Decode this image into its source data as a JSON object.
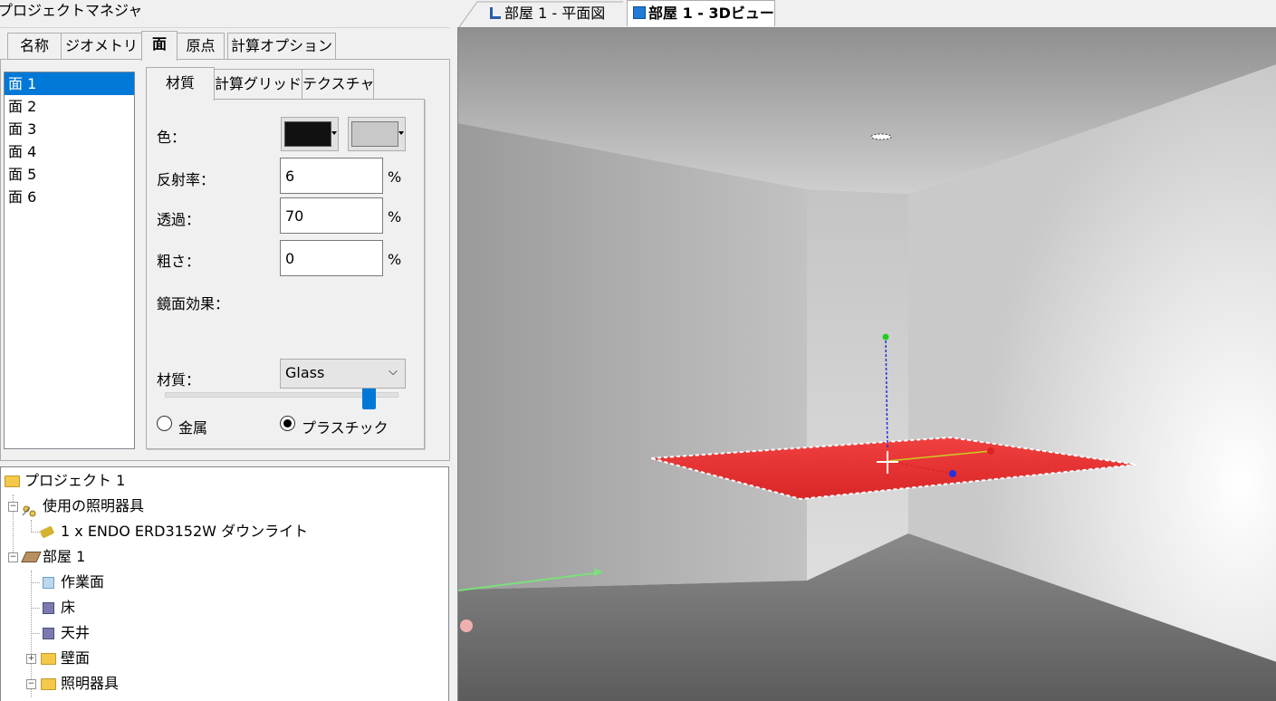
{
  "project_manager": {
    "title": "プロジェクトマネジャ",
    "tabs": [
      "名称",
      "ジオメトリ",
      "面",
      "原点",
      "計算オプション"
    ],
    "active_tab": "面"
  },
  "faces": {
    "items": [
      "面 1",
      "面 2",
      "面 3",
      "面 4",
      "面 5",
      "面 6"
    ],
    "selected": "面 1"
  },
  "material_tabs": [
    "材質",
    "計算グリッド",
    "テクスチャ"
  ],
  "material": {
    "color_label": "色：",
    "color_primary": "#111111",
    "color_secondary": "#c8c8c8",
    "reflectance_label": "反射率：",
    "reflectance_value": "6",
    "transmission_label": "透過：",
    "transmission_value": "70",
    "roughness_label": "粗さ：",
    "roughness_value": "0",
    "percent_unit": "%",
    "specular_label": "鏡面効果：",
    "specular_level": 0.88,
    "type_label": "材質：",
    "type_value": "Glass",
    "radio_metal": "金属",
    "radio_plastic": "プラスチック",
    "radio_selected": "plastic"
  },
  "tree": {
    "project": "プロジェクト 1",
    "luminaires_used": "使用の照明器具",
    "luminaire_item": "1 x ENDO ERD3152W ダウンライト",
    "room": "部屋 1",
    "workplane": "作業面",
    "floor": "床",
    "ceiling": "天井",
    "walls": "壁面",
    "luminaires": "照明器具"
  },
  "view_tabs": {
    "plan": "部屋 1 - 平面図",
    "view3d": "部屋 1 - 3Dビュー",
    "active": "view3d"
  },
  "colors": {
    "selection": "#0078d7",
    "plane": "#e53535",
    "axis_x": "#dd2222",
    "axis_y": "#22cc22",
    "axis_z": "#2233dd"
  }
}
